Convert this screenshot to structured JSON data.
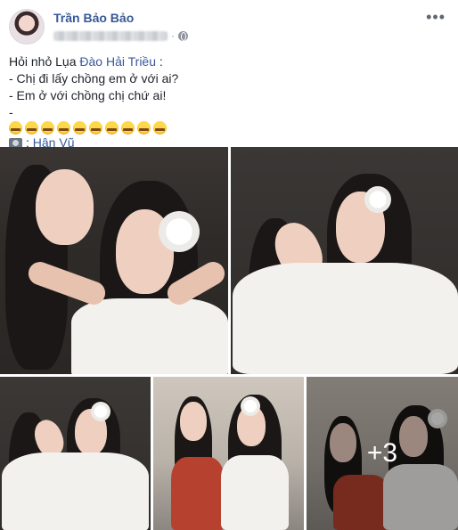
{
  "post": {
    "author": "Trần Bảo Bảo",
    "text_line1_prefix": "Hỏi nhỏ Lụa ",
    "text_line1_mention": "Đào Hải Triều",
    "text_line1_suffix": " :",
    "text_line2": "- Chị đi lấy chồng em ở với ai?",
    "text_line3": "- Em ở với chồng chị chứ ai!",
    "text_line4_prefix": "- ",
    "emoji_count": 10,
    "photo_credit_prefix": ": ",
    "photo_credit_name": "Hân Vũ"
  },
  "icons": {
    "more": "more-horizontal-icon",
    "privacy": "globe-icon",
    "camera": "camera-icon",
    "emoji": "grimacing-emoji-icon"
  },
  "gallery": {
    "more_count_label": "+3"
  },
  "colors": {
    "link": "#385898",
    "text": "#1d2129",
    "meta": "#90949c"
  }
}
